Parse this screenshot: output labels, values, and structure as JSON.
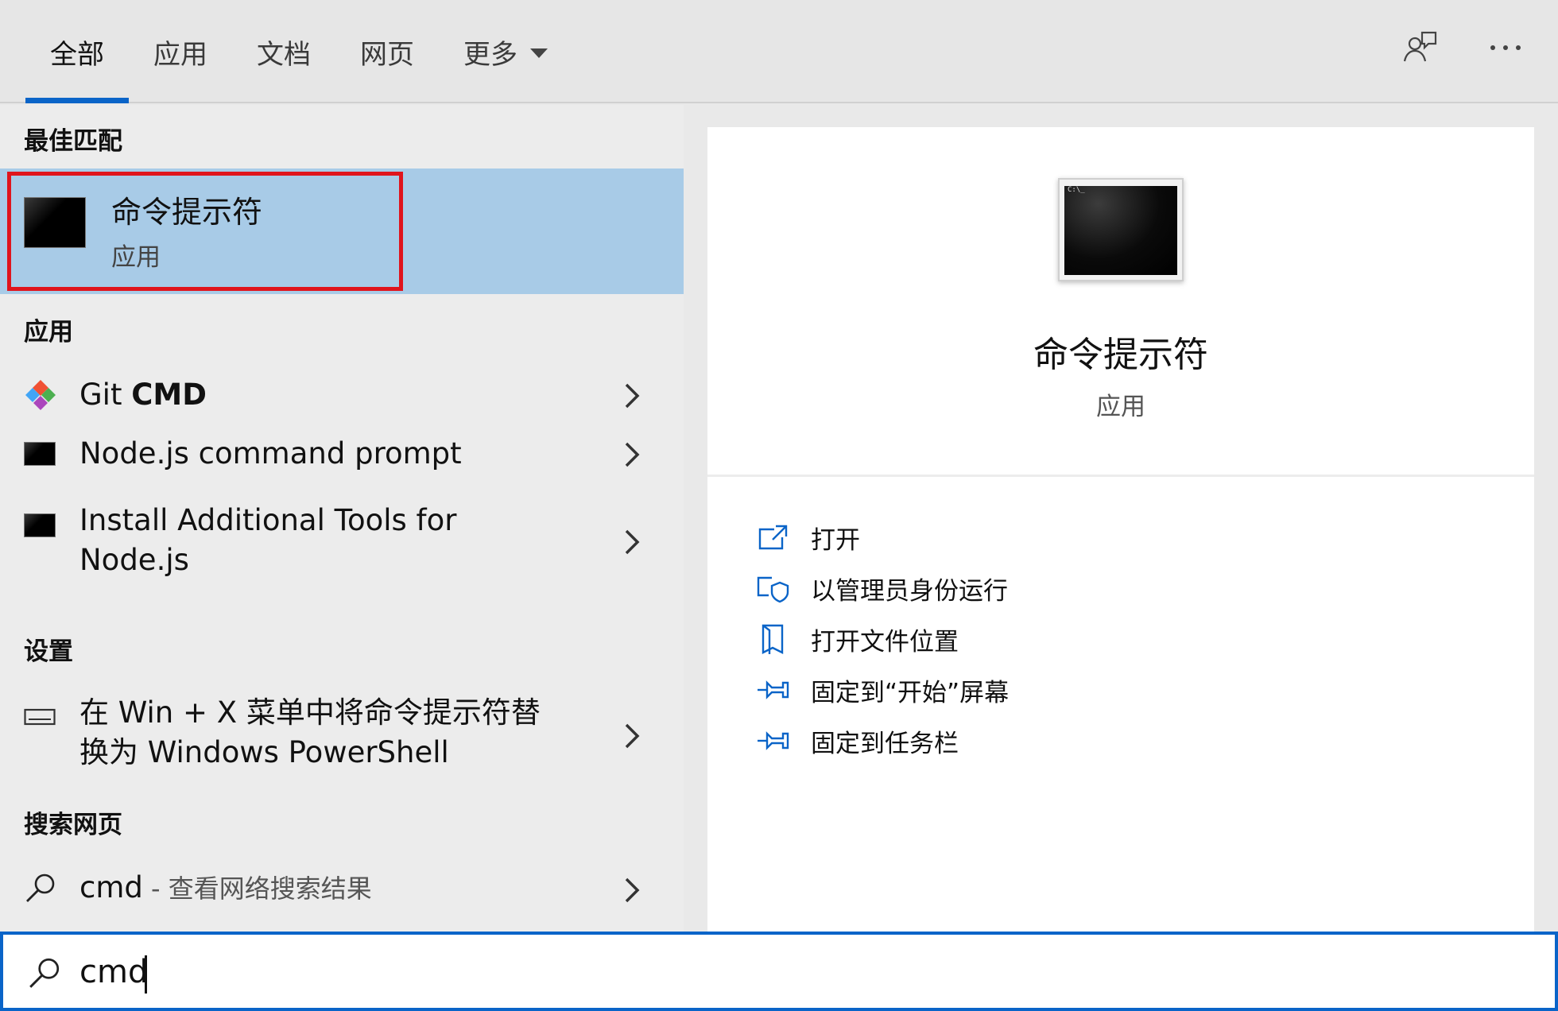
{
  "tabs": [
    {
      "label": "全部",
      "active": true
    },
    {
      "label": "应用",
      "active": false
    },
    {
      "label": "文档",
      "active": false
    },
    {
      "label": "网页",
      "active": false
    },
    {
      "label": "更多",
      "active": false
    }
  ],
  "top_icons": [
    "feedback-icon",
    "more-options-icon"
  ],
  "left": {
    "best_match_header": "最佳匹配",
    "best_match": {
      "title": "命令提示符",
      "subtitle": "应用",
      "icon": "terminal-icon"
    },
    "apps_header": "应用",
    "apps": [
      {
        "name": "Git ",
        "name_bold": "CMD",
        "icon": "git-icon"
      },
      {
        "name": "Node.js command prompt",
        "icon": "terminal-icon"
      },
      {
        "line1": "Install Additional Tools for",
        "line2": "Node.js",
        "icon": "terminal-icon"
      }
    ],
    "settings_header": "设置",
    "settings": [
      {
        "line1": "在 Win + X 菜单中将命令提示符替",
        "line2": "换为 Windows PowerShell",
        "icon": "keyboard-icon"
      }
    ],
    "web_header": "搜索网页",
    "web": {
      "query": "cmd",
      "suffix": " - 查看网络搜索结果",
      "icon": "search-icon"
    }
  },
  "right": {
    "title": "命令提示符",
    "subtitle": "应用",
    "icon_text": "C:\\_",
    "actions": [
      {
        "label": "打开",
        "icon": "open-icon"
      },
      {
        "label": "以管理员身份运行",
        "icon": "run-as-admin-icon"
      },
      {
        "label": "打开文件位置",
        "icon": "file-location-icon"
      },
      {
        "label": "固定到“开始”屏幕",
        "icon": "pin-icon"
      },
      {
        "label": "固定到任务栏",
        "icon": "pin-icon"
      }
    ]
  },
  "search": {
    "value": "cmd",
    "icon": "search-icon"
  },
  "colors": {
    "accent": "#0a64c8",
    "selected_bg": "#a8cbe7",
    "highlight_outline": "#e0141c"
  }
}
